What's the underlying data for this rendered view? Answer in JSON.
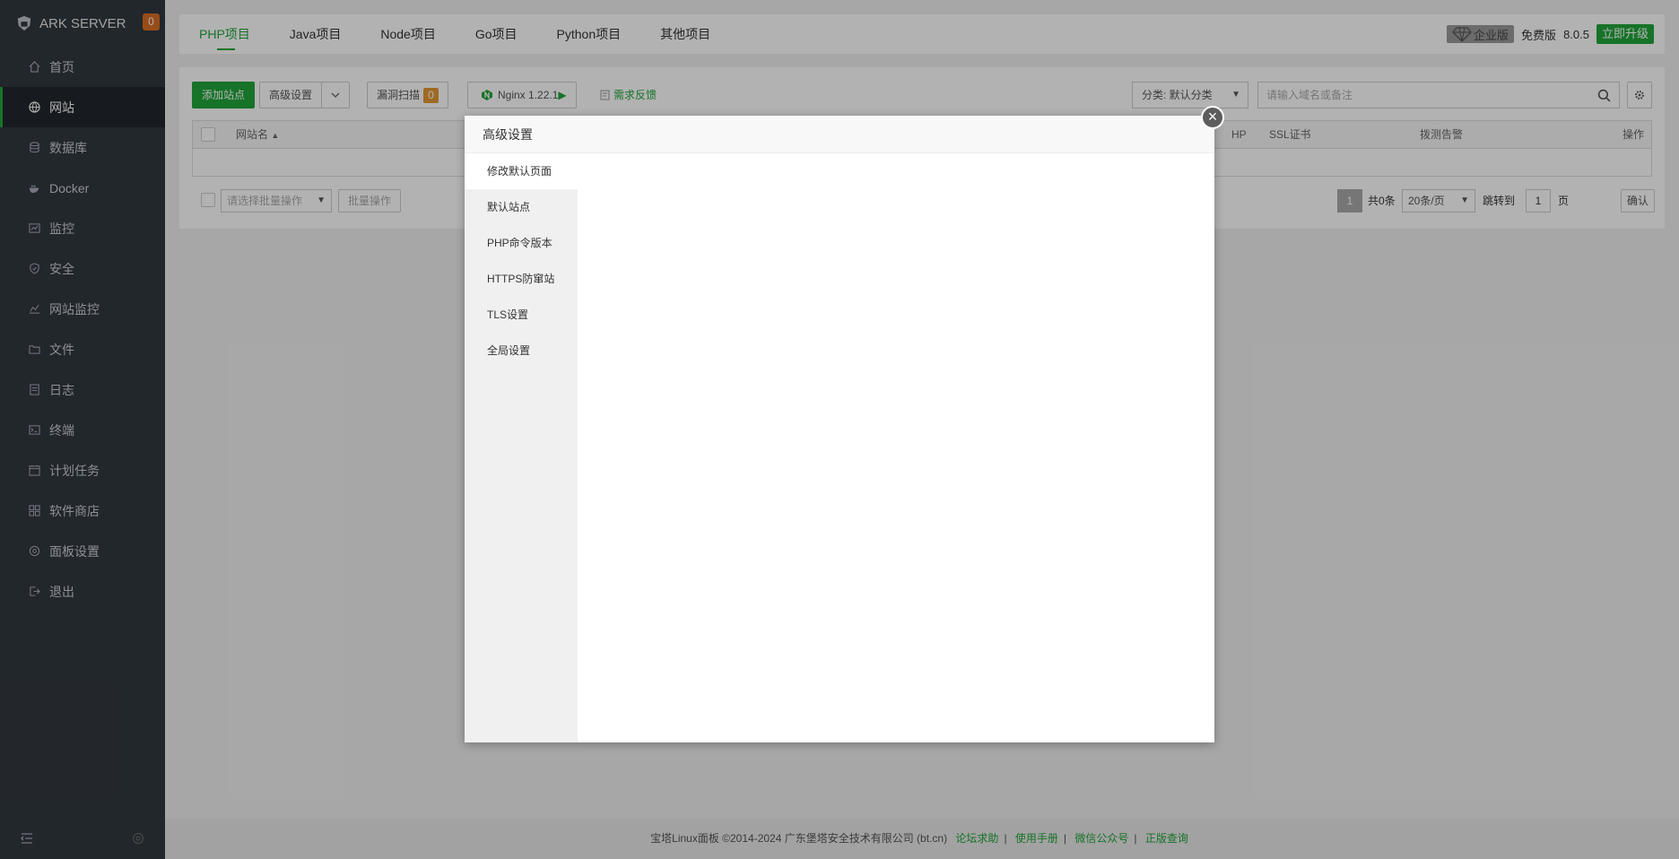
{
  "sidebar": {
    "brand": "ARK SERVER",
    "badge": "0",
    "items": [
      {
        "label": "首页"
      },
      {
        "label": "网站"
      },
      {
        "label": "数据库"
      },
      {
        "label": "Docker"
      },
      {
        "label": "监控"
      },
      {
        "label": "安全"
      },
      {
        "label": "网站监控"
      },
      {
        "label": "文件"
      },
      {
        "label": "日志"
      },
      {
        "label": "终端"
      },
      {
        "label": "计划任务"
      },
      {
        "label": "软件商店"
      },
      {
        "label": "面板设置"
      },
      {
        "label": "退出"
      }
    ]
  },
  "topbar": {
    "tabs": [
      "PHP项目",
      "Java项目",
      "Node项目",
      "Go项目",
      "Python项目",
      "其他项目"
    ],
    "enterprise": "企业版",
    "free": "免费版",
    "version": "8.0.5",
    "upgrade": "立即升级"
  },
  "toolbar": {
    "add_site": "添加站点",
    "advanced": "高级设置",
    "scan": "漏洞扫描",
    "scan_count": "0",
    "nginx": "Nginx 1.22.1",
    "feedback": "需求反馈",
    "category": "分类: 默认分类",
    "search_placeholder": "请输入域名或备注"
  },
  "table": {
    "col_name": "网站名",
    "col_php": "HP",
    "col_ssl": "SSL证书",
    "col_alarm": "拨测告警",
    "col_ops": "操作"
  },
  "bottom": {
    "batch_placeholder": "请选择批量操作",
    "batch_btn": "批量操作",
    "page": "1",
    "total": "共0条",
    "per_page": "20条/页",
    "jump_to": "跳转到",
    "jump_value": "1",
    "page_unit": "页",
    "confirm": "确认"
  },
  "footer": {
    "copyright": "宝塔Linux面板 ©2014-2024 广东堡塔安全技术有限公司 (bt.cn)",
    "links": [
      "论坛求助",
      "使用手册",
      "微信公众号",
      "正版查询"
    ]
  },
  "modal": {
    "title": "高级设置",
    "menu": [
      "修改默认页面",
      "默认站点",
      "PHP命令版本",
      "HTTPS防窜站",
      "TLS设置",
      "全局设置"
    ]
  },
  "colors": {
    "accent": "#20a53a",
    "sidebar": "#32383f",
    "badge": "#d86e25"
  }
}
